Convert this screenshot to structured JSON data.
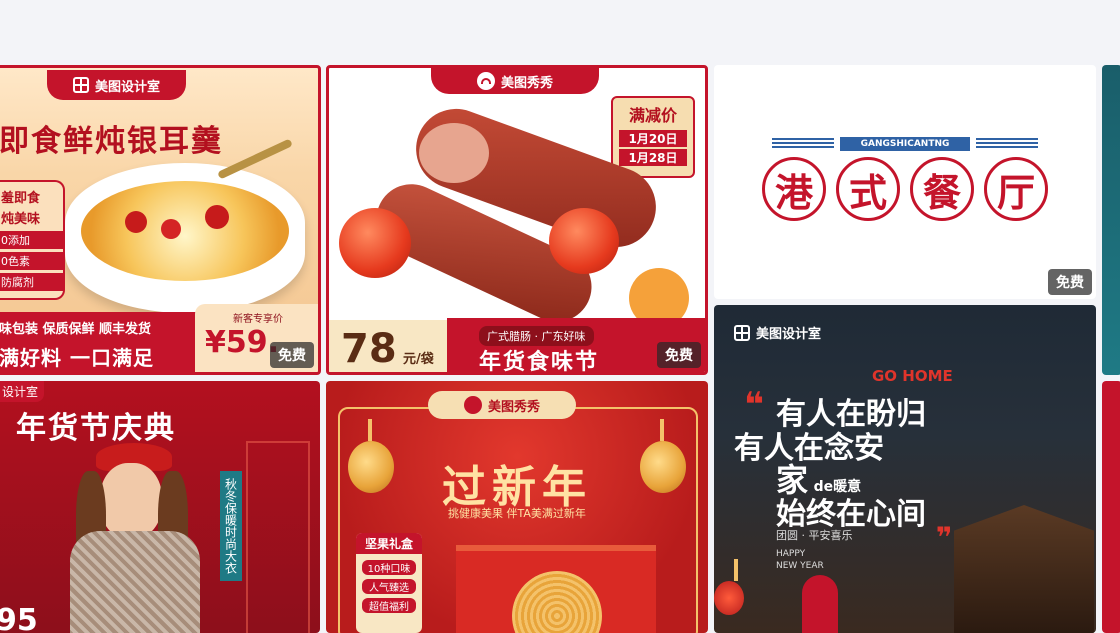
{
  "colors": {
    "red": "#c4142b",
    "darkred": "#8d0f1b",
    "gold": "#f4c26a",
    "cream": "#fff2d8",
    "bg": "#f3f4f8"
  },
  "badges": {
    "free": "免费"
  },
  "card1": {
    "brand": "美图设计室",
    "title": "即食鲜炖银耳羹",
    "side": [
      "羞即食",
      "炖美味",
      "0添加",
      "0色素",
      "防腐剂"
    ],
    "bottom_line": "味包装 保质保鲜 顺丰发货",
    "slogan": "满好料 一口满足",
    "price_label": "新客专享价",
    "price": "¥59.",
    "icon": "bowl-icon"
  },
  "card2": {
    "brand": "美图秀秀",
    "promo_title": "满减价",
    "promo_dates": [
      "1月20日",
      "1月28日"
    ],
    "price_num": "78",
    "price_unit": "元/袋",
    "tag_small": "广式腊肠 · 广东好味",
    "tag_big": "年货食味节",
    "icon": "sausage-icon"
  },
  "card3": {
    "sub": "GANGSHICANTNG",
    "chars": [
      "港",
      "式",
      "餐",
      "厅"
    ]
  },
  "card4": {
    "brand": "设计室",
    "title": "年货节庆典",
    "side": "秋冬保暖时尚大衣",
    "num": "95",
    "icon": "model-icon"
  },
  "card5": {
    "brand": "美图秀秀",
    "title": "过新年",
    "subtitle": "挑健康美果 伴TA美满过新年",
    "box_title": "坚果礼盒",
    "box_items": [
      "10种口味",
      "人气臻选",
      "超值福利"
    ],
    "icon": "lantern-icon"
  },
  "card6": {
    "brand": "美图设计室",
    "go_home": "GO HOME",
    "lines": [
      "有人在盼归",
      "有人在念安",
      "家",
      "de暖意",
      "始终在心间"
    ],
    "small1": "团圆 · 平安喜乐",
    "small2": "HAPPY",
    "small3": "NEW YEAR"
  }
}
